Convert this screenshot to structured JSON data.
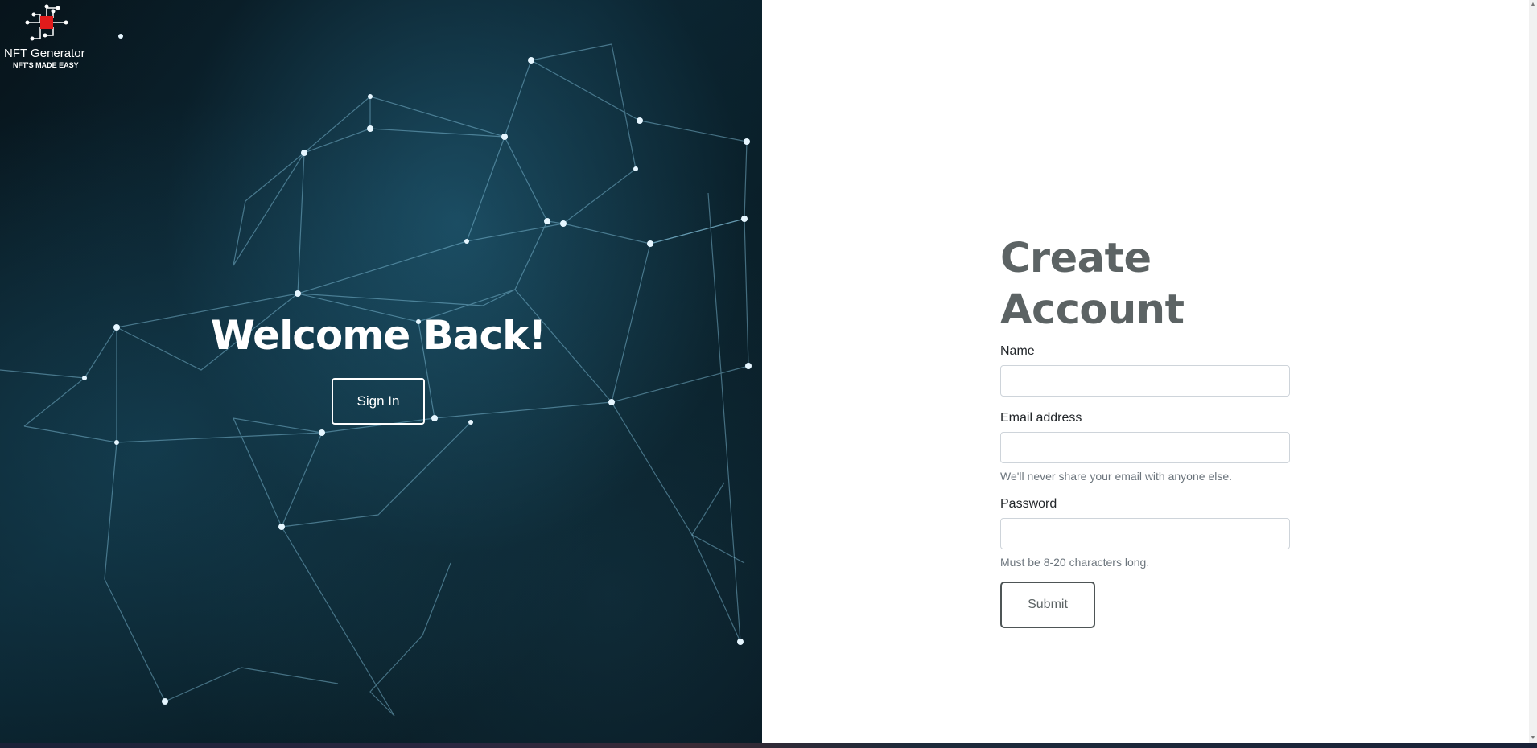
{
  "brand": {
    "name": "NFT Generator",
    "tagline": "NFT'S MADE EASY",
    "accent_color": "#e11b1b"
  },
  "welcome": {
    "title": "Welcome Back!",
    "signin_label": "Sign In"
  },
  "form": {
    "title": "Create Account",
    "name_label": "Name",
    "email_label": "Email address",
    "email_help": "We'll never share your email with anyone else.",
    "password_label": "Password",
    "password_help": "Must be 8-20 characters long.",
    "submit_label": "Submit",
    "name_value": "",
    "email_value": "",
    "password_value": ""
  }
}
